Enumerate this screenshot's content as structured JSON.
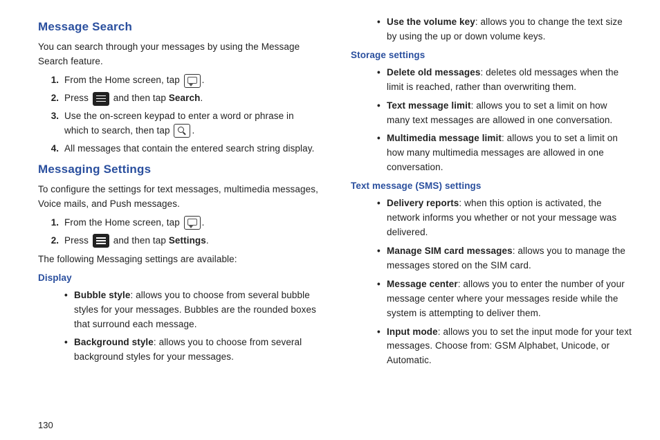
{
  "page_number": "130",
  "left": {
    "section1": {
      "title": "Message Search",
      "intro": "You can search through your messages by using the Message Search feature.",
      "steps": {
        "s1a": "From the Home screen, tap ",
        "s1b": ".",
        "s2a": "Press ",
        "s2b": " and then tap ",
        "s2c": "Search",
        "s2d": ".",
        "s3a": "Use the on-screen keypad to enter a word or phrase in which to search, then tap ",
        "s3b": ".",
        "s4": "All messages that contain the entered search string display."
      }
    },
    "section2": {
      "title": "Messaging Settings",
      "intro": "To configure the settings for text messages, multimedia messages, Voice mails, and Push messages.",
      "steps": {
        "s1a": "From the Home screen, tap ",
        "s1b": ".",
        "s2a": "Press ",
        "s2b": " and then tap ",
        "s2c": "Settings",
        "s2d": "."
      },
      "after": "The following Messaging settings are available:",
      "sub_display": "Display",
      "display_items": {
        "i1t": "Bubble style",
        "i1d": ": allows you to choose from several bubble styles for your messages. Bubbles are the rounded boxes that surround each message.",
        "i2t": "Background style",
        "i2d": ": allows you to choose from several background styles for your messages."
      }
    }
  },
  "right": {
    "top_item": {
      "t": "Use the volume key",
      "d": ": allows you to change the text size by using the up or down volume keys."
    },
    "sub_storage": "Storage settings",
    "storage_items": {
      "i1t": "Delete old messages",
      "i1d": ": deletes old messages when the limit is reached, rather than overwriting them.",
      "i2t": "Text message limit",
      "i2d": ": allows you to set a limit on how many text messages are allowed in one conversation.",
      "i3t": "Multimedia message limit",
      "i3d": ": allows you to set a limit on how many multimedia messages are allowed in one conversation."
    },
    "sub_sms": "Text message (SMS) settings",
    "sms_items": {
      "i1t": "Delivery reports",
      "i1d": ": when this option is activated, the network informs you whether or not your message was delivered.",
      "i2t": "Manage SIM card messages",
      "i2d": ": allows you to manage the messages stored on the SIM card.",
      "i3t": "Message center",
      "i3d": ": allows you to enter the number of your message center where your messages reside while the system is attempting to deliver them.",
      "i4t": "Input mode",
      "i4d": ": allows you to set the input mode for your text messages. Choose from: GSM Alphabet, Unicode, or Automatic."
    }
  }
}
